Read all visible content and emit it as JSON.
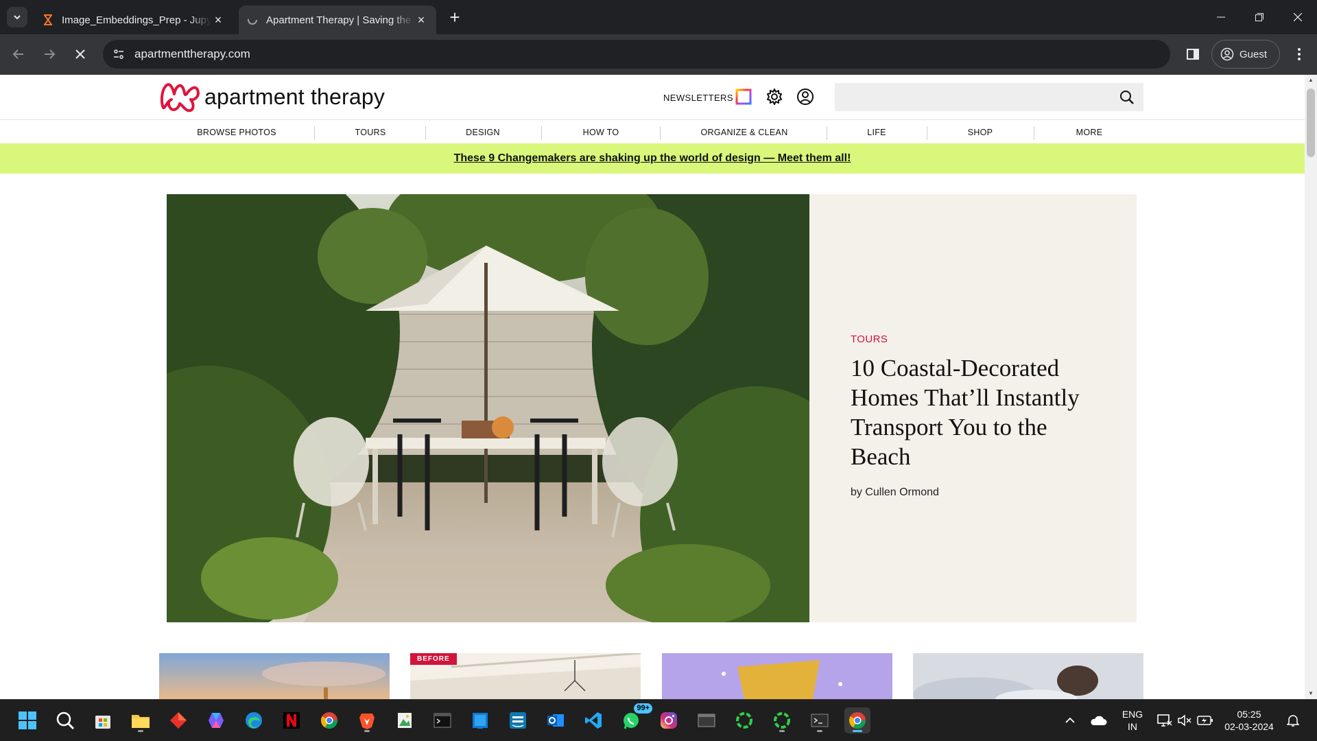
{
  "browser": {
    "tabs": [
      {
        "title": "Image_Embeddings_Prep - Jupy",
        "active": false,
        "favicon": "hourglass-icon"
      },
      {
        "title": "Apartment Therapy | Saving the",
        "active": true,
        "favicon": "loading-icon"
      }
    ],
    "new_tab_symbol": "+",
    "url": "apartmenttherapy.com",
    "profile_label": "Guest"
  },
  "site": {
    "logo_text": "apartment therapy",
    "newsletters_label": "NEWSLETTERS",
    "search_placeholder": "",
    "brand_color": "#d2143a",
    "nav": [
      "BROWSE PHOTOS",
      "TOURS",
      "DESIGN",
      "HOW TO",
      "ORGANIZE & CLEAN",
      "LIFE",
      "SHOP",
      "MORE"
    ],
    "promo_text": "These 9 Changemakers are shaking up the world of design — Meet them all!",
    "promo_color": "#d9f77b",
    "hero": {
      "category": "TOURS",
      "headline": "10 Coastal-Decorated Homes That’ll Instantly Transport You to the Beach",
      "byline": "by Cullen Ormond"
    },
    "cards": [
      {
        "badge": ""
      },
      {
        "badge": "BEFORE"
      },
      {
        "badge": ""
      },
      {
        "badge": ""
      }
    ]
  },
  "taskbar": {
    "apps": [
      "windows-start-icon",
      "search-icon",
      "microsoft-store-icon",
      "file-explorer-icon",
      "app-red-diamond-icon",
      "copilot-icon",
      "edge-icon",
      "netflix-icon",
      "chrome-icon",
      "brave-icon",
      "photos-icon",
      "terminal-icon",
      "app-blue-window-icon",
      "prime-video-icon",
      "outlook-icon",
      "vscode-icon",
      "whatsapp-icon",
      "instagram-icon",
      "app-grey-window-icon",
      "app-green-ring-icon",
      "app-green-ring-2-icon",
      "terminal-2-icon",
      "chrome-active-icon"
    ],
    "whatsapp_badge": "99+",
    "language_line1": "ENG",
    "language_line2": "IN",
    "time": "05:25",
    "date": "02-03-2024"
  }
}
